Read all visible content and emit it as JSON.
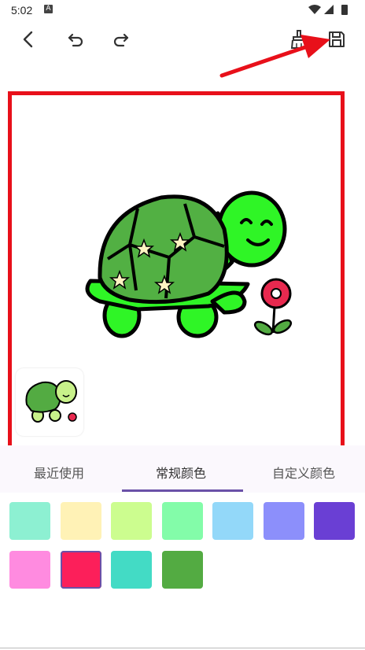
{
  "status": {
    "time": "5:02",
    "a_label": "A"
  },
  "tabs": [
    {
      "label": "最近使用"
    },
    {
      "label": "常规颜色"
    },
    {
      "label": "自定义颜色"
    }
  ],
  "palette": {
    "selected_index": 8,
    "colors": [
      "#8df0d2",
      "#fff2b6",
      "#ccfd8f",
      "#83fca9",
      "#93d8f9",
      "#8c8ffb",
      "#6a3fd4",
      "#ff8be0",
      "#fc1f5a",
      "#43dbc5",
      "#53ab42"
    ]
  },
  "icons": {
    "back": "chevron-left-icon",
    "undo": "undo-icon",
    "redo": "redo-icon",
    "clear": "broom-icon",
    "save": "save-icon"
  },
  "accent_color": "#6a51a8",
  "highlight_color": "#e8101a"
}
